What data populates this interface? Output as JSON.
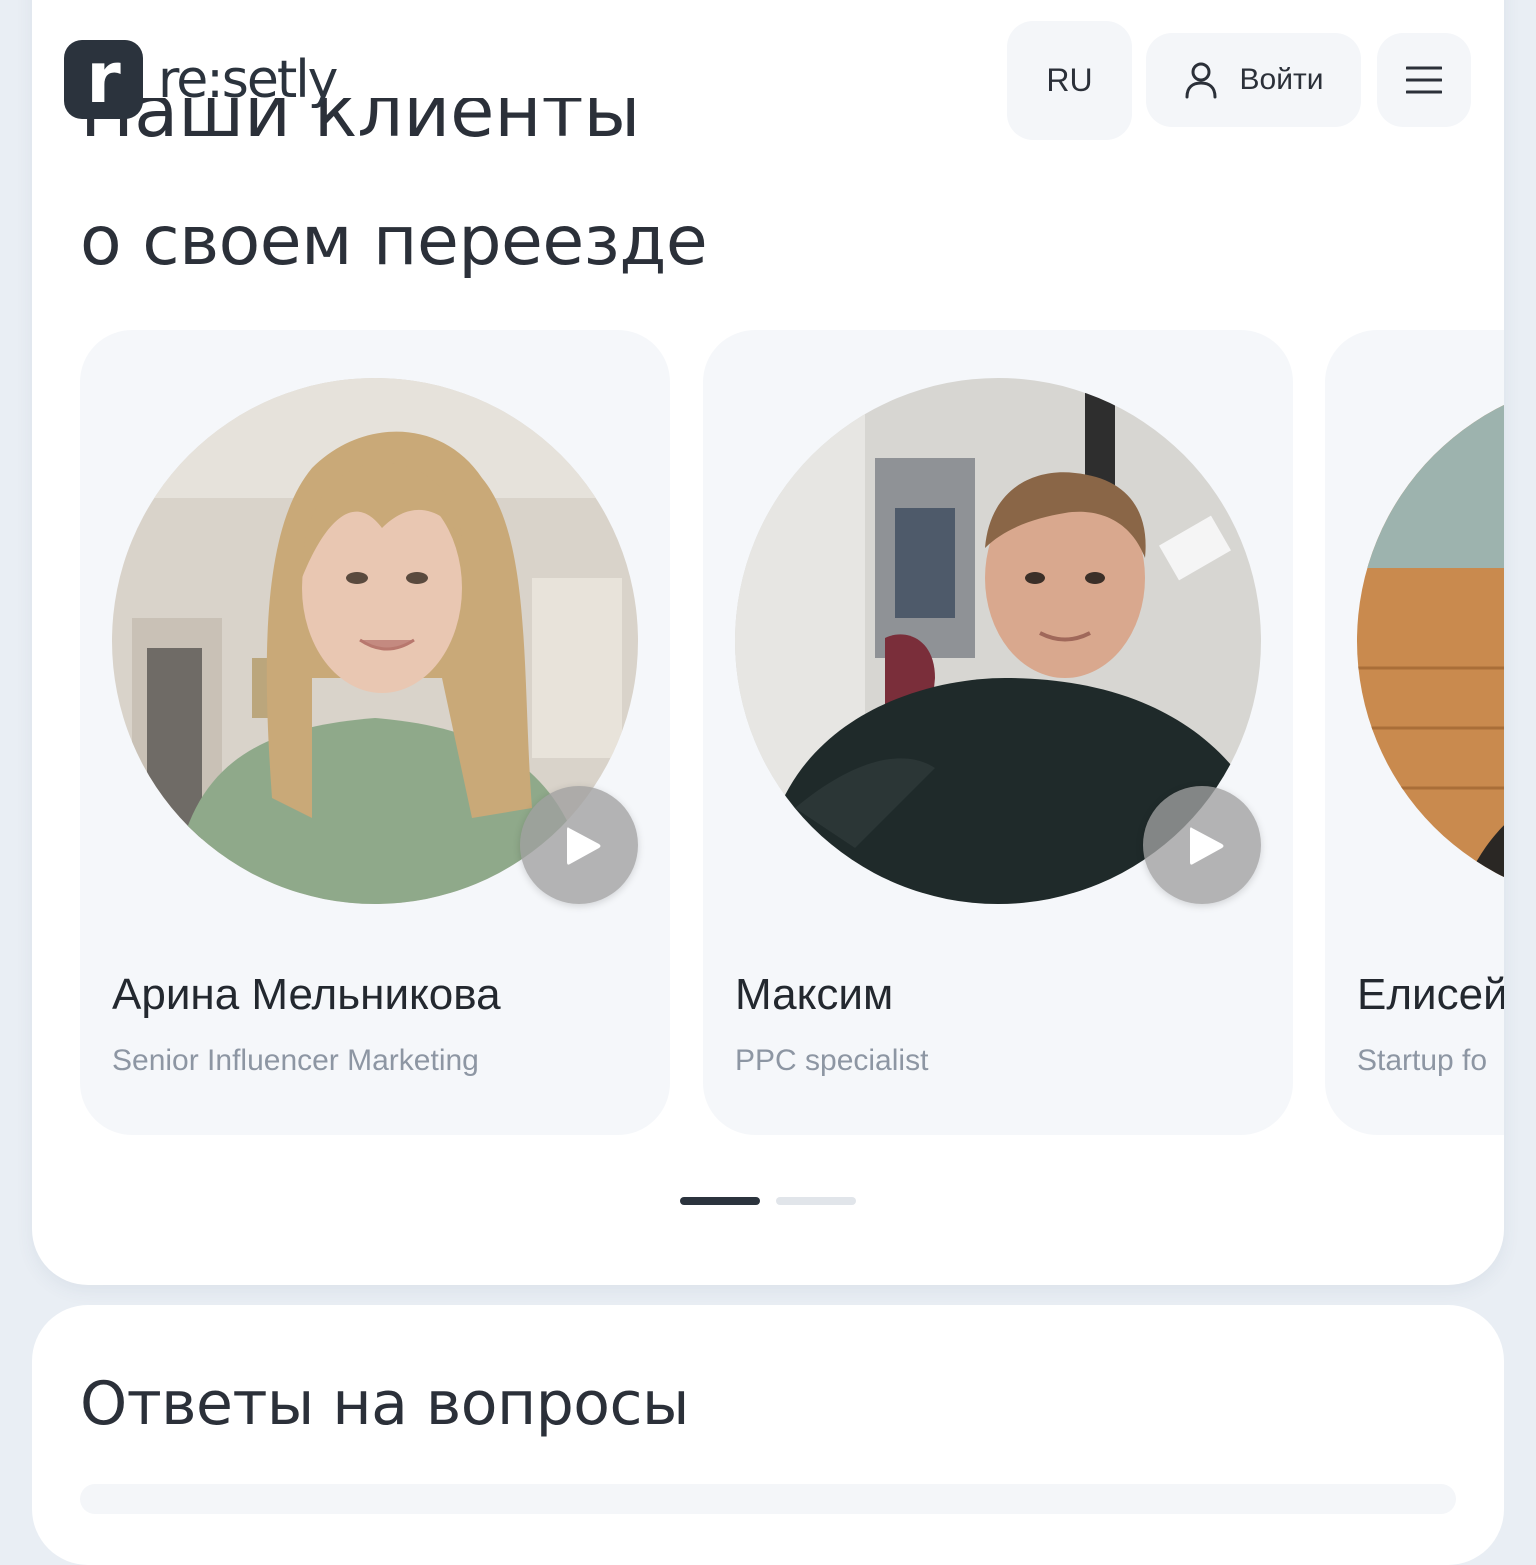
{
  "brand": {
    "mark": "r",
    "name": "re:setly"
  },
  "header": {
    "language": "RU",
    "login_label": "Войти"
  },
  "reviews": {
    "title_line1": "Наши клиенты",
    "title_line2": "о своем переезде",
    "cards": [
      {
        "name": "Арина Мельникова",
        "role": "Senior Influencer Marketing"
      },
      {
        "name": "Максим",
        "role": "PPC specialist"
      },
      {
        "name": "Елисей",
        "role": "Startup fo"
      }
    ],
    "pagination": {
      "pages": 2,
      "active": 1
    }
  },
  "faq": {
    "title": "Ответы на вопросы"
  },
  "colors": {
    "text": "#2b3039",
    "muted": "#8d96a3",
    "card": "#f5f7fa",
    "dot_active": "#2b333d",
    "dot_inactive": "#e1e5ea"
  }
}
